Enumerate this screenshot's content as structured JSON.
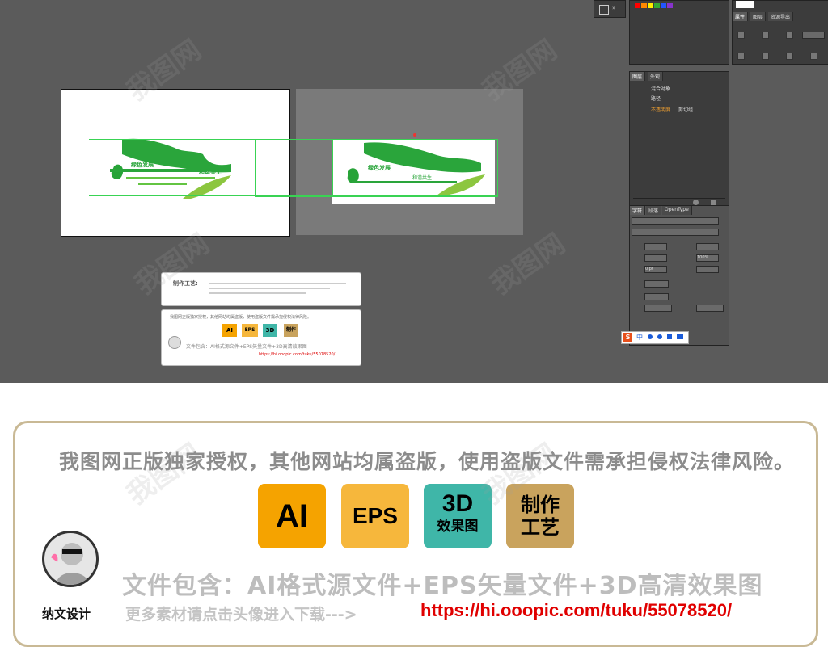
{
  "editor": {
    "layers_panel": {
      "tabs": [
        "属性",
        "图层",
        "资源导出"
      ],
      "items": [
        "混合对象",
        "路径",
        "不透明度"
      ],
      "item_suffix": "剪切组"
    },
    "char_panel": {
      "tabs": [
        "字符",
        "段落",
        "OpenType"
      ],
      "percent": "100%",
      "value_pt": "0 pt"
    },
    "swatches": [
      "#ff0000",
      "#ff8800",
      "#ffee00",
      "#33aa33",
      "#2255ff",
      "#8833cc",
      "#ffffff",
      "#000000"
    ],
    "ime_bar": {
      "logo": "S",
      "mode": "中"
    },
    "canvas_card": {
      "craft_label": "制作工艺:",
      "copyright_small": "我图网正版独家授权，其他网站均属盗版，使用盗版文件需承担侵权法律风险。",
      "badges_small": [
        "AI",
        "EPS",
        "3D",
        "制作"
      ],
      "contains_small": "文件包含：AI格式源文件+EPS矢量文件+3D高清效果图",
      "link_small": "https://hi.ooopic.com/tuku/55078520/"
    }
  },
  "banner": {
    "copyright": "我图网正版独家授权，其他网站均属盗版，使用盗版文件需承担侵权法律风险。",
    "badges": [
      {
        "line1": "AI",
        "line2": "",
        "color": "#f5a300"
      },
      {
        "line1": "EPS",
        "line2": "",
        "color": "#f6b73c"
      },
      {
        "line1": "3D",
        "line2": "效果图",
        "color": "#3fb6a8"
      },
      {
        "line1": "制作",
        "line2": "工艺",
        "color": "#c9a35d"
      }
    ],
    "contains": "文件包含：AI格式源文件+EPS矢量文件+3D高清效果图",
    "author": "纳文设计",
    "more": "更多素材请点击头像进入下载--->",
    "link": "https://hi.ooopic.com/tuku/55078520/"
  },
  "watermark_text": "我图网"
}
